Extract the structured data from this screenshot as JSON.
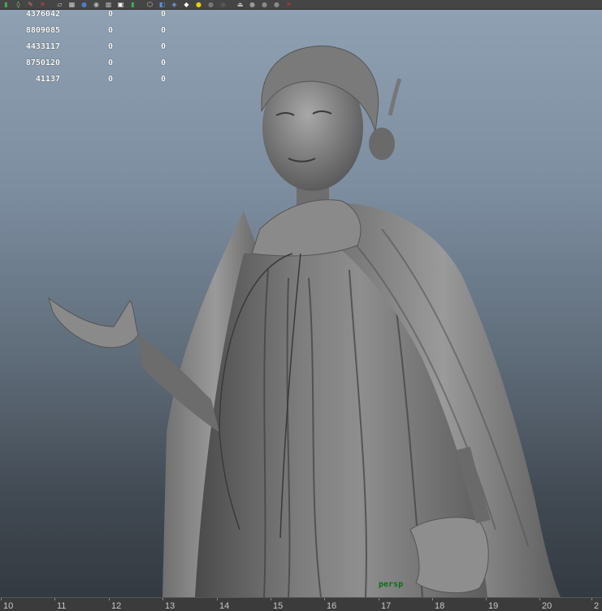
{
  "toolbar": {
    "icons": [
      {
        "name": "select-tool-icon",
        "glyph": "▮",
        "color": "#3cb44b"
      },
      {
        "name": "lasso-tool-icon",
        "glyph": "◊",
        "color": "#8fd18f"
      },
      {
        "name": "paint-select-icon",
        "glyph": "✎",
        "color": "#e07070"
      },
      {
        "name": "move-tool-icon",
        "glyph": "✕",
        "color": "#d04040"
      },
      {
        "name": "render-region-icon",
        "glyph": "▱",
        "color": "#cccccc"
      },
      {
        "name": "render-frame-icon",
        "glyph": "▦",
        "color": "#cccccc"
      },
      {
        "name": "ipr-render-icon",
        "glyph": "●",
        "color": "#4a7fd0"
      },
      {
        "name": "render-settings-icon",
        "glyph": "◉",
        "color": "#bbbbbb"
      },
      {
        "name": "hypershade-icon",
        "glyph": "▩",
        "color": "#aaaaaa"
      },
      {
        "name": "graph-editor-icon",
        "glyph": "▣",
        "color": "#ffffff"
      },
      {
        "name": "attribute-editor-icon",
        "glyph": "▮",
        "color": "#3cb44b"
      },
      {
        "name": "cube-icon",
        "glyph": "⬡",
        "color": "#cccccc"
      },
      {
        "name": "wireframe-icon",
        "glyph": "◧",
        "color": "#5b8fd6"
      },
      {
        "name": "smooth-shade-icon",
        "glyph": "◈",
        "color": "#6b9ee0"
      },
      {
        "name": "texture-icon",
        "glyph": "◆",
        "color": "#ffffff"
      },
      {
        "name": "default-light-icon",
        "glyph": "●",
        "color": "#e6d200"
      },
      {
        "name": "shadow-icon",
        "glyph": "●",
        "color": "#777777"
      },
      {
        "name": "ambient-occlusion-icon",
        "glyph": "●",
        "color": "#555555"
      },
      {
        "name": "camera-gate-icon",
        "glyph": "⏏",
        "color": "#bbbbbb"
      },
      {
        "name": "isolate-select-icon",
        "glyph": "●",
        "color": "#999999"
      },
      {
        "name": "xray-icon",
        "glyph": "●",
        "color": "#8a8a8a"
      },
      {
        "name": "xray-joints-icon",
        "glyph": "●",
        "color": "#8a8a8a"
      },
      {
        "name": "hide-show-icon",
        "glyph": "✕",
        "color": "#cc3333"
      }
    ]
  },
  "viewport": {
    "camera": "persp",
    "hud": [
      [
        "4376042",
        "0",
        "0"
      ],
      [
        "8809085",
        "0",
        "0"
      ],
      [
        "4433117",
        "0",
        "0"
      ],
      [
        "8750120",
        "0",
        "0"
      ],
      [
        "41137",
        "0",
        "0"
      ]
    ]
  },
  "timeslider": {
    "ticks": [
      "10",
      "11",
      "12",
      "13",
      "14",
      "15",
      "16",
      "17",
      "18",
      "19",
      "20",
      "2"
    ]
  }
}
